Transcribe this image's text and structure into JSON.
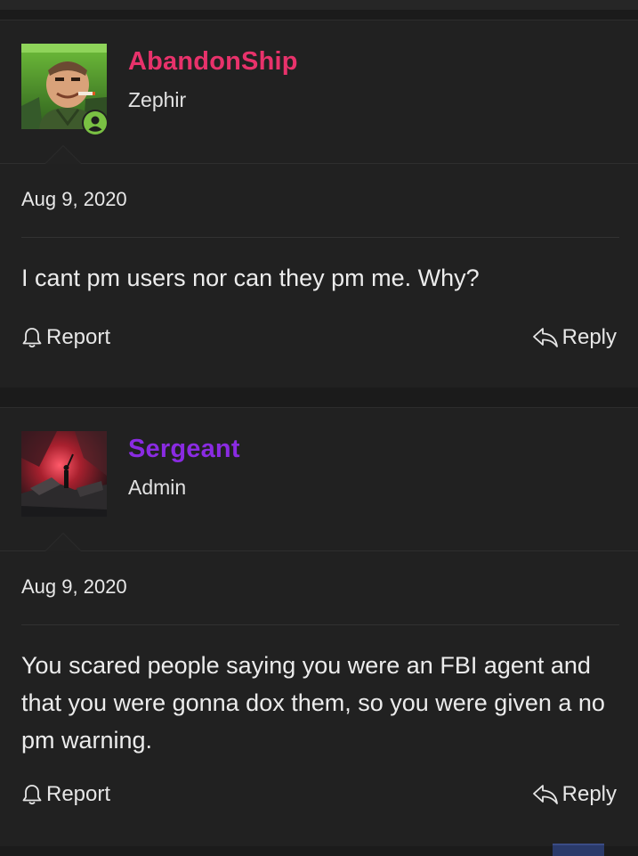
{
  "posts": [
    {
      "username": "AbandonShip",
      "username_color": "#e8326b",
      "user_title": "Zephir",
      "online": true,
      "date": "Aug 9, 2020",
      "message": "I cant pm users nor can they pm me. Why?",
      "report_label": "Report",
      "reply_label": "Reply"
    },
    {
      "username": "Sergeant",
      "username_color": "#8a2be2",
      "user_title": "Admin",
      "online": false,
      "date": "Aug 9, 2020",
      "message": "You scared people saying you were an FBI agent and that you were gonna dox them, so you were given a no pm warning.",
      "report_label": "Report",
      "reply_label": "Reply"
    }
  ],
  "icons": {
    "report": "bell-icon",
    "reply": "reply-arrow-icon",
    "online": "user-online-icon"
  },
  "colors": {
    "online_badge": "#7ac143",
    "background": "#212121"
  }
}
